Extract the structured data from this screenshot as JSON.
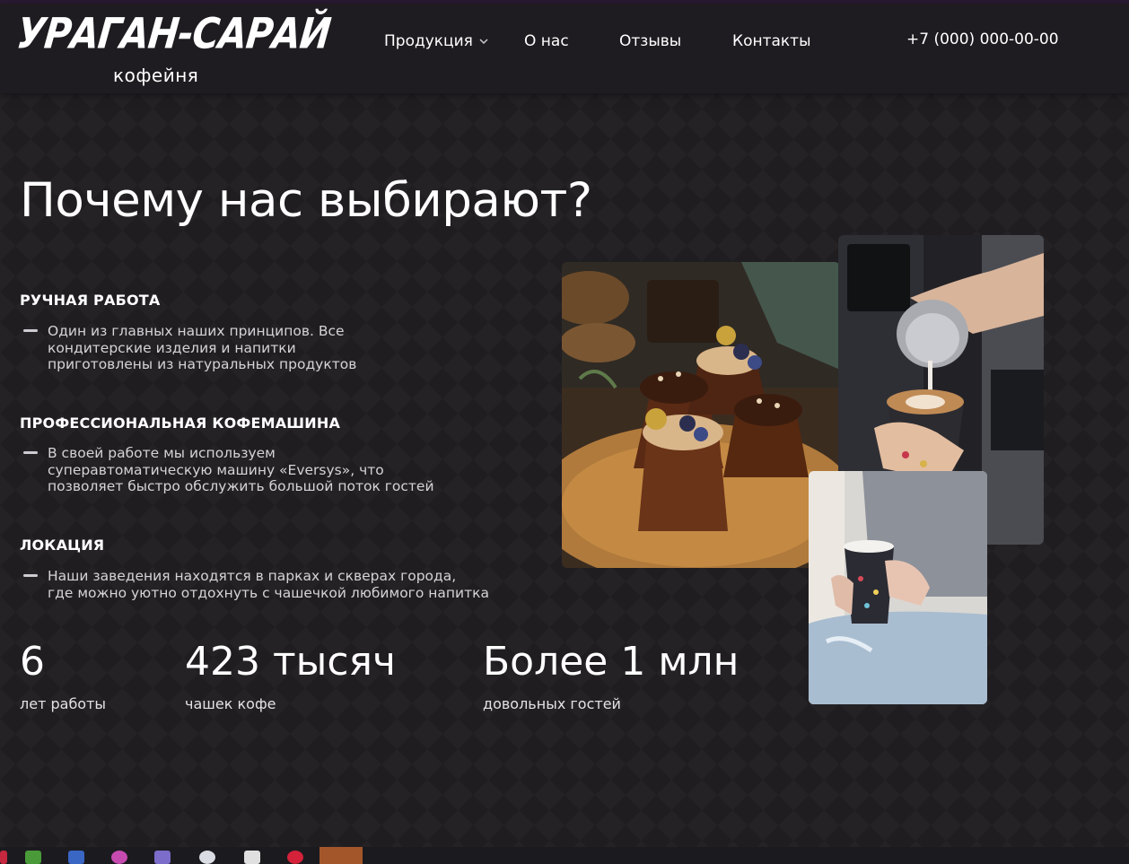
{
  "header": {
    "logo_title": "УРАГАН-САРАЙ",
    "logo_subtitle": "кофейня",
    "nav": [
      {
        "label": "Продукция",
        "has_dropdown": true
      },
      {
        "label": "О нас"
      },
      {
        "label": "Отзывы"
      },
      {
        "label": "Контакты"
      }
    ],
    "phone": "+7 (000) 000-00-00"
  },
  "main": {
    "title": "Почему нас выбирают?",
    "features": [
      {
        "title": "РУЧНАЯ РАБОТА",
        "lines": [
          "Один из главных наших принципов. Все",
          "кондитерские изделия и напитки",
          "приготовлены из натуральных продуктов"
        ]
      },
      {
        "title": "ПРОФЕССИОНАЛЬНАЯ КОФЕМАШИНА",
        "lines": [
          "В своей работе мы используем",
          "суперавтоматическую машину «Eversys», что",
          "позволяет быстро обслужить большой поток гостей"
        ]
      },
      {
        "title": "ЛОКАЦИЯ",
        "lines": [
          "Наши заведения находятся в парках и скверах города,",
          "где можно уютно отдохнуть с чашечкой любимого напитка"
        ]
      }
    ],
    "stats": [
      {
        "value": "6",
        "label": "лет работы"
      },
      {
        "value": "423 тысяч",
        "label": "чашек кофе"
      },
      {
        "value": "Более 1 млн",
        "label": "довольных гостей"
      }
    ],
    "photos": [
      "cupcakes-photo",
      "latte-art-photo",
      "coffee-cup-photo"
    ]
  },
  "colors": {
    "background": "#201d21",
    "header": "#1f1c21",
    "text": "#ffffff",
    "muted_text": "#d6d3d8"
  }
}
